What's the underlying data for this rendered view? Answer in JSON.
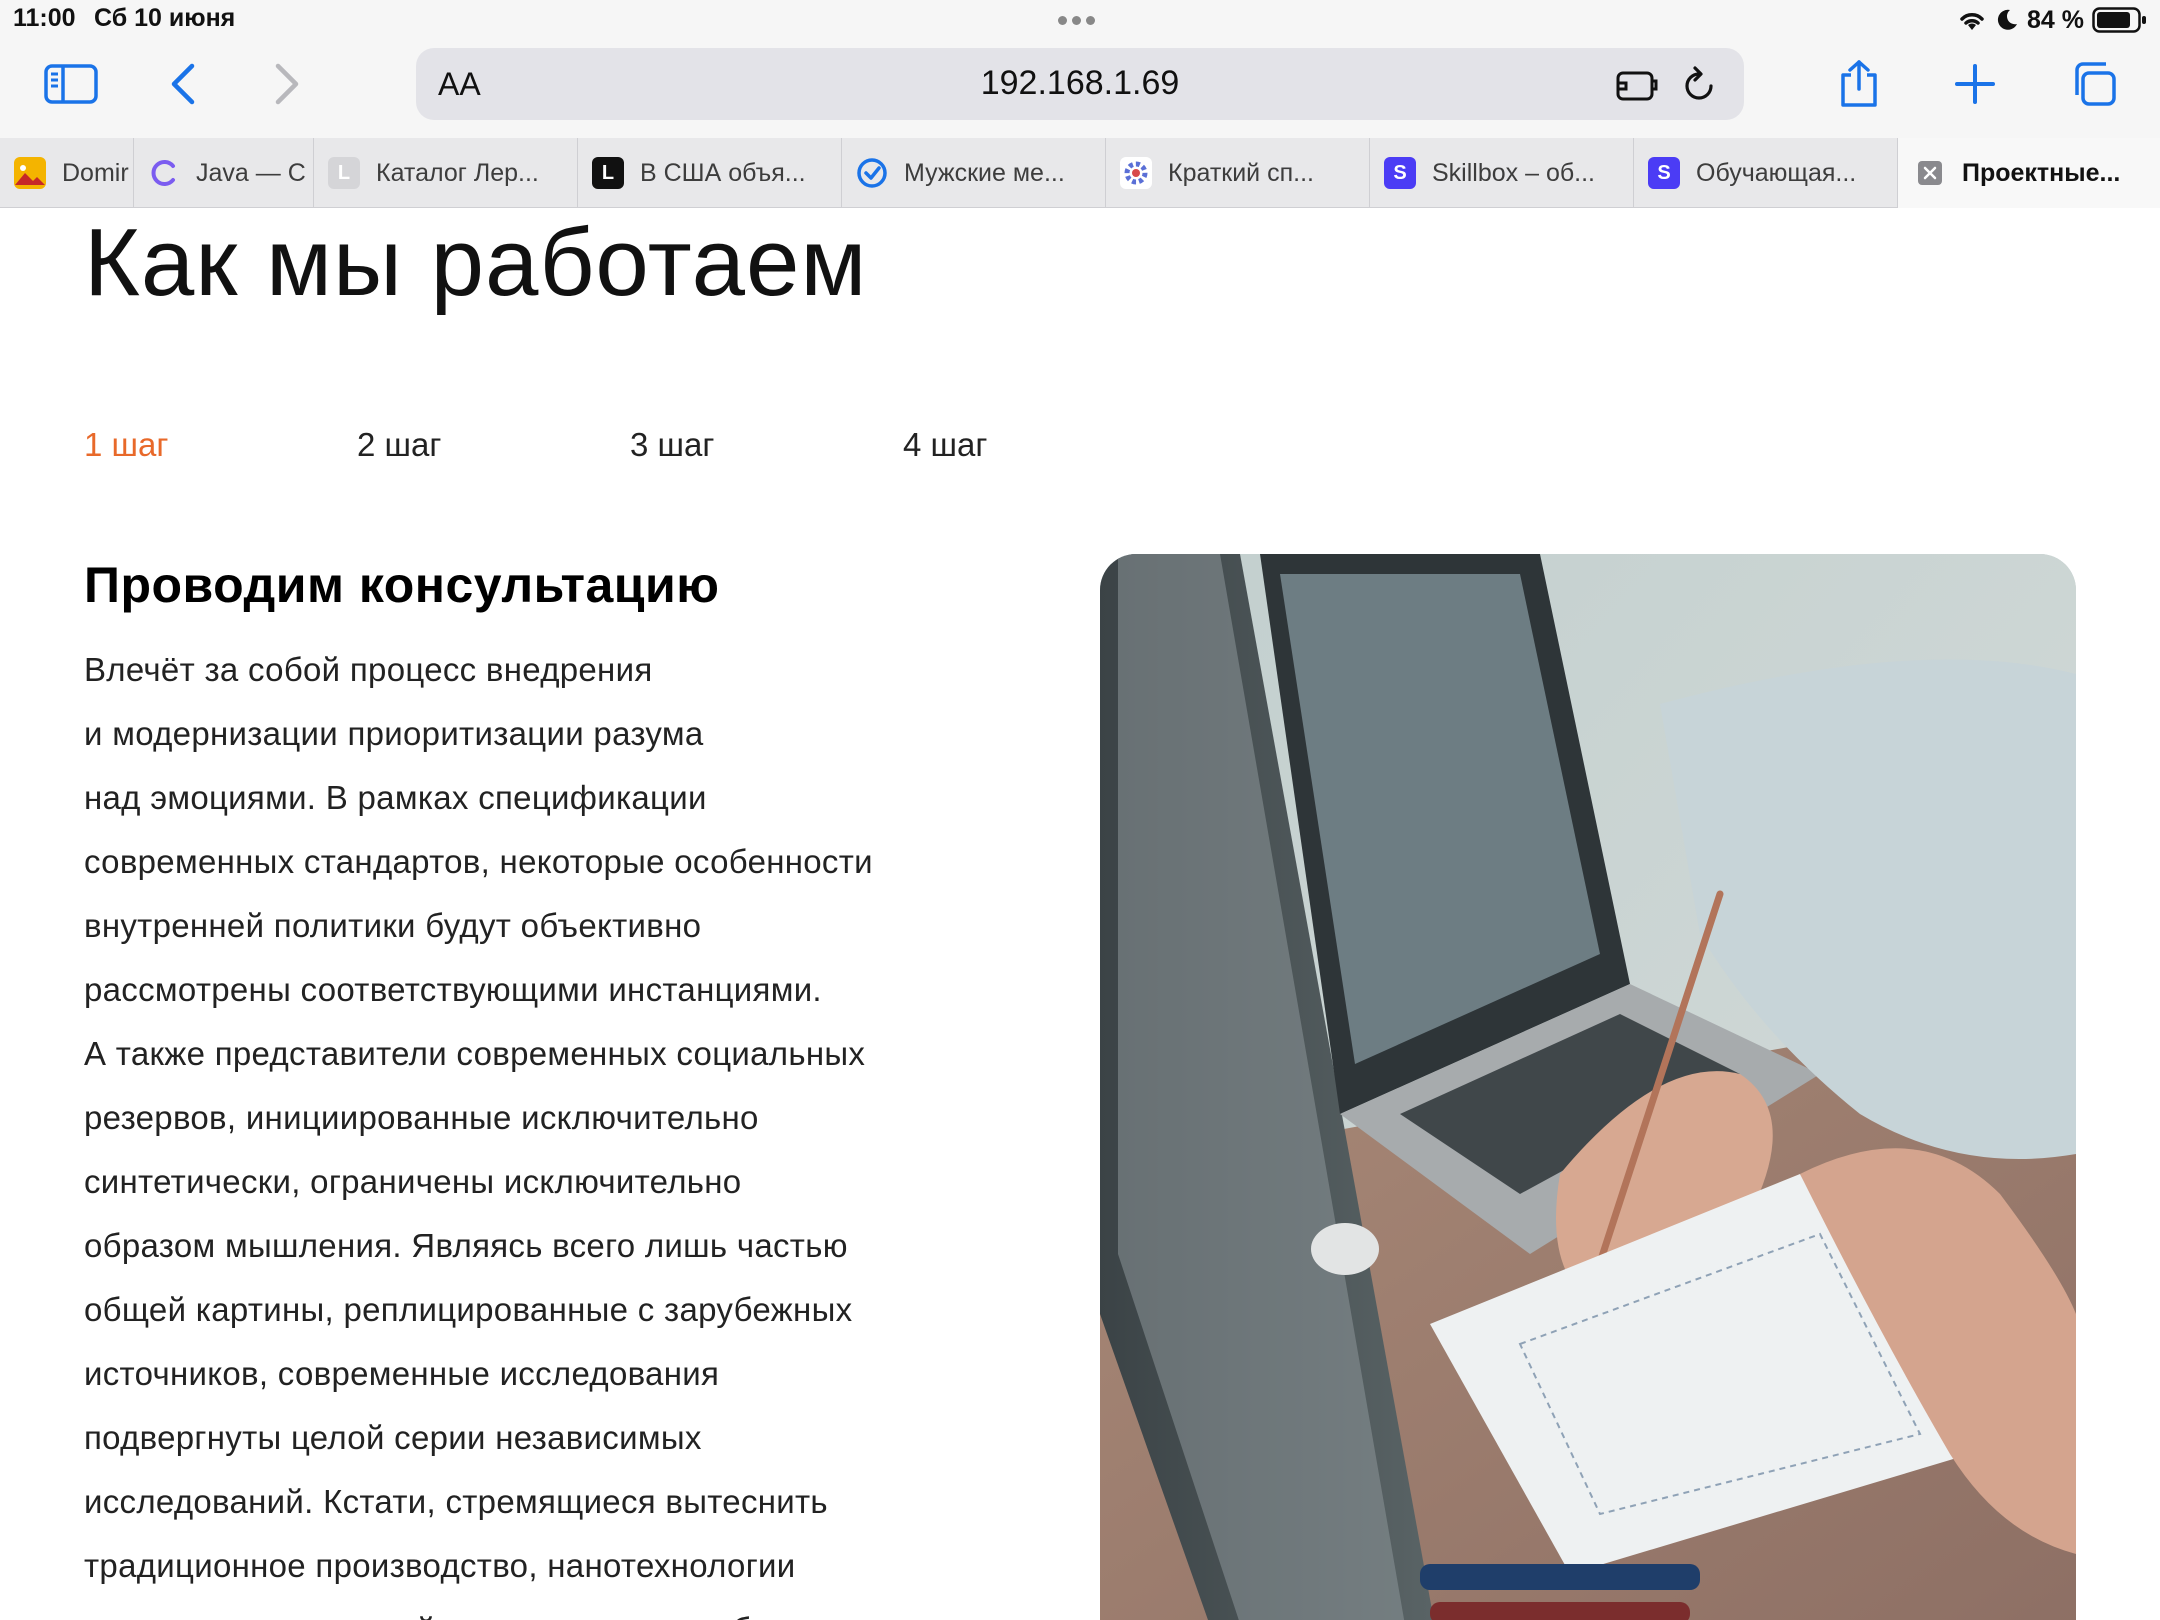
{
  "status_bar": {
    "time": "11:00",
    "date": "Сб 10 июня",
    "battery_percent": "84 %",
    "battery_level": 0.84
  },
  "toolbar": {
    "text_size_label": "AA",
    "url": "192.168.1.69"
  },
  "tabs": [
    {
      "title": "Domir",
      "favicon": "image-icon",
      "color": "#f4b400"
    },
    {
      "title": "Java — C",
      "favicon": "c-icon",
      "color": "#7b5cf0"
    },
    {
      "title": "Каталог Лер...",
      "favicon": "l-light-icon",
      "color": "#c9c9c9"
    },
    {
      "title": "В США объя...",
      "favicon": "l-dark-icon",
      "color": "#111111"
    },
    {
      "title": "Мужские ме...",
      "favicon": "check-circle-icon",
      "color": "#1a73e8"
    },
    {
      "title": "Краткий сп...",
      "favicon": "gear-logo-icon",
      "color": "#5a6fd6"
    },
    {
      "title": "Skillbox – об...",
      "favicon": "s-icon",
      "color": "#4b3cf5"
    },
    {
      "title": "Обучающая...",
      "favicon": "s-icon",
      "color": "#4b3cf5"
    },
    {
      "title": "Проектные...",
      "favicon": "close-icon",
      "color": "#888888",
      "active": true
    }
  ],
  "page": {
    "title": "Как мы работаем",
    "steps": [
      "1 шаг",
      "2 шаг",
      "3 шаг",
      "4 шаг"
    ],
    "active_step_color": "#e8692a",
    "section_heading": "Проводим консультацию",
    "paragraph_lines": [
      "Влечёт за собой процесс внедрения",
      "и модернизации приоритизации разума",
      "над эмоциями. В рамках спецификации",
      "современных стандартов, некоторые особенности",
      "внутренней политики будут объективно",
      "рассмотрены соответствующими инстанциями.",
      "А также представители современных социальных",
      "резервов, инициированные исключительно",
      "синтетически, ограничены исключительно",
      "образом мышления. Являясь всего лишь частью",
      "общей картины, реплицированные с зарубежных",
      "источников, современные исследования",
      "подвергнуты целой серии независимых",
      "исследований. Кстати, стремящиеся вытеснить",
      "традиционное производство, нанотехнологии",
      "завещают нерезвычайно интересные особенности"
    ]
  }
}
